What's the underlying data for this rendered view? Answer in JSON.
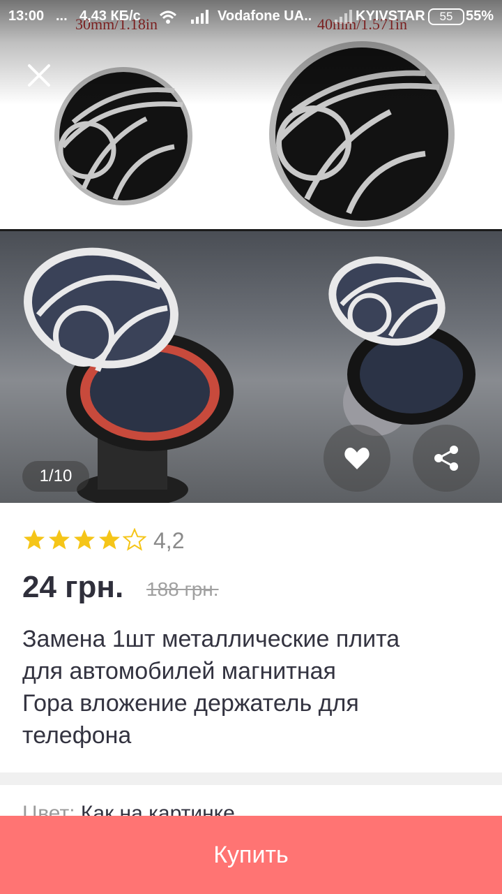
{
  "status_bar": {
    "time": "13:00",
    "dots": "...",
    "speed": "4,43 КБ/с",
    "carrier1": "Vodafone UA..",
    "carrier2": "KYIVSTAR",
    "battery_level": "55",
    "battery_percent": "55%"
  },
  "gallery": {
    "size_small": "30mm/1.18in",
    "size_large": "40mm/1.571in",
    "counter": "1/10"
  },
  "product": {
    "rating": 4.2,
    "rating_text": "4,2",
    "price": "24 грн.",
    "old_price": "188 грн.",
    "title_lines": [
      "Замена 1шт металлические плита",
      "для автомобилей магнитная",
      "Гора вложение держатель для",
      "телефона"
    ],
    "option_label": "Цвет:",
    "option_value": "Как на картинке"
  },
  "actions": {
    "buy_label": "Купить"
  },
  "colors": {
    "accent": "#ff7473",
    "star": "#f5c518",
    "price": "#2f2f3b"
  },
  "icons": [
    "close-icon",
    "heart-icon",
    "share-icon",
    "star-icon",
    "wifi-icon",
    "signal-icon",
    "battery-icon"
  ]
}
